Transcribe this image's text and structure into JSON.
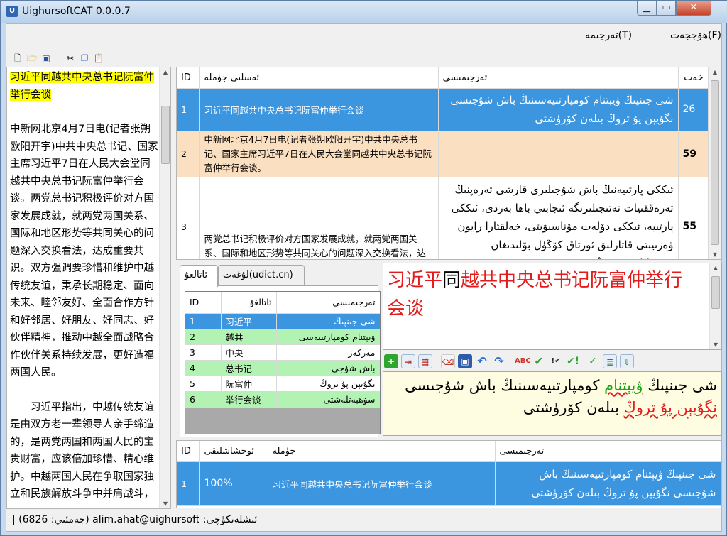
{
  "window": {
    "title": "UighursoftCAT 0.0.0.7",
    "min_glyph": "▁",
    "max_glyph": "▭",
    "close_glyph": "✕"
  },
  "menu": {
    "file": "ھۆججەت(F)",
    "translate": "تەرجىمە(T)"
  },
  "left_text": {
    "title_highlight": "习近平同越共中央总书记阮富仲举行会谈",
    "para1": "中新网北京4月7日电(记者张朔欧阳开宇)中共中央总书记、国家主席习近平7日在人民大会堂同越共中央总书记阮富仲举行会谈。两党总书记积极评价对方国家发展成就，就两党两国关系、国际和地区形势等共同关心的问题深入交换看法，达成重要共识。双方强调要珍惜和维护中越传统友谊，秉承长期稳定、面向未来、睦邻友好、全面合作方针和好邻居、好朋友、好同志、好伙伴精神，推动中越全面战略合作伙伴关系持续发展，更好造福两国人民。",
    "para2": "习近平指出，中越传统友谊是由双方老一辈领导人亲手缔造的，是两党两国和两国人民的宝贵财富，应该倍加珍惜、精心维护。中越两国人民在争取国家独立和民族解放斗争中并肩战斗，"
  },
  "segments": {
    "headers": {
      "id": "ID",
      "source": "ئەسلىي جۈملە",
      "target": "تەرجىمىسى",
      "chars": "خەت"
    },
    "rows": [
      {
        "id": "1",
        "source": "习近平同越共中央总书记阮富仲举行会谈",
        "target": "شى جىنپىڭ ۋيېتنام كومپارتىيەسىنىڭ باش شۇجىسى نگۇيېن پۇ تروڭ بىلەن كۆرۈشتى",
        "chars": "26"
      },
      {
        "id": "2",
        "source": "中新网北京4月7日电(记者张朔欧阳开宇)中共中央总书记、国家主席习近平7日在人民大会堂同越共中央总书记阮富仲举行会谈。",
        "target": "",
        "chars": "59"
      },
      {
        "id": "3",
        "source": "两党总书记积极评价对方国家发展成就，就两党两国关系、国际和地区形势等共同关心的问题深入交换看法，达成重要共识。",
        "target": "ئىككى پارتىيەنىڭ باش شۇجىلىرى قارشى تەرەپنىڭ تەرەققىيات نەتىجىلىرىگە ئىجابىي باھا بەردى، ئىككى پارتىيە، ئىككى دۆلەت مۇناسىۋىتى، خەلقئارا رايون ۋەزىيىتى قاتارلىق ئورتاق كۆڭۈل بۆلىدىغان مەسىلىلەردە چوڭقۇر",
        "chars": "55"
      }
    ]
  },
  "tabs": {
    "terms": "ئاتالغۇ",
    "dict": "لۇغەت(udict.cn)"
  },
  "terms": {
    "headers": {
      "id": "ID",
      "term": "ئاتالغۇ",
      "translation": "تەرجىمىسى"
    },
    "rows": [
      {
        "id": "1",
        "term": "习近平",
        "translation": "شى جىنپىڭ"
      },
      {
        "id": "2",
        "term": "越共",
        "translation": "ۋيېتنام كومپارتىيەسى"
      },
      {
        "id": "3",
        "term": "中央",
        "translation": "مەركەز"
      },
      {
        "id": "4",
        "term": "总书记",
        "translation": "باش شۇجى"
      },
      {
        "id": "5",
        "term": "阮富仲",
        "translation": "نگۇيېن پۇ تروڭ"
      },
      {
        "id": "6",
        "term": "举行会谈",
        "translation": "سۆھبەتلەشتى"
      }
    ]
  },
  "source_segment": {
    "part_a": "习近平",
    "part_b": "同",
    "part_c": "越共中央总书记阮富仲举行会谈"
  },
  "target_segment": {
    "w1": "شى جىنپىڭ",
    "w2": "ۋيېتنام",
    "w3": "كومپارتىيەسىنىڭ باش شۇجىسى",
    "w4": "نگۇيېن پۇ تروڭ",
    "w5": "بىلەن كۆرۈشتى"
  },
  "tm": {
    "headers": {
      "id": "ID",
      "match": "ئوخشاشلىقى",
      "source": "جۈملە",
      "target": "تەرجىمىسى"
    },
    "rows": [
      {
        "id": "1",
        "match": "100%",
        "source": "习近平同越共中央总书记阮富仲举行会谈",
        "target": "شى جىنپىڭ ۋيېتنام كومپارتىيەسىنىڭ باش شۇجىسى نگۇيېن پۇ تروڭ بىلەن كۆرۈشتى"
      }
    ]
  },
  "status": {
    "text": "| (6826 :جەمئىي) alim.ahat@uighursoft :ئىشلەتكۈچى"
  }
}
